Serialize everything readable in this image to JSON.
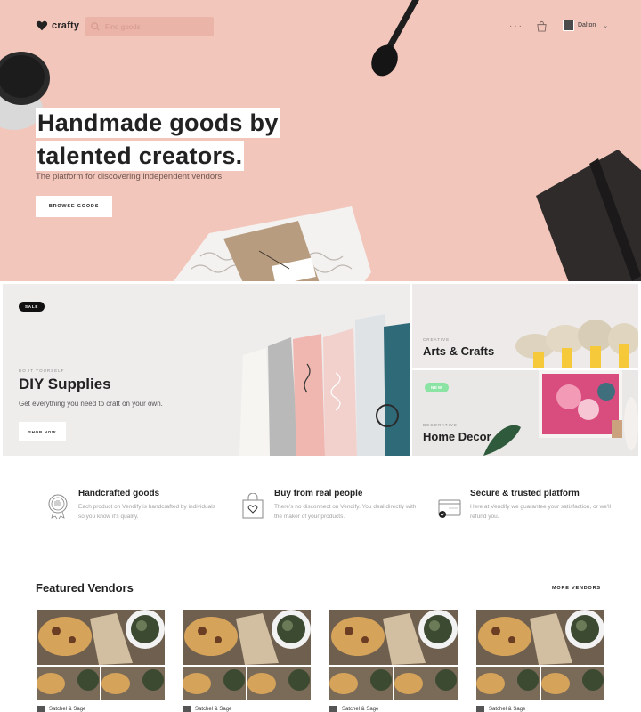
{
  "nav": {
    "logo_text": "crafty",
    "search_placeholder": "Find goods",
    "more_label": "···",
    "user_name": "Dalton"
  },
  "hero": {
    "title_line1": "Handmade goods by",
    "title_line2": "talented creators.",
    "subtitle": "The platform for discovering independent vendors.",
    "button_label": "BROWSE GOODS",
    "background": "#f3c6bb"
  },
  "tiles": {
    "diy": {
      "badge": "SALE",
      "kicker": "DO IT YOURSELF",
      "title": "DIY Supplies",
      "description": "Get everything you need to craft on your own.",
      "button_label": "SHOP NOW"
    },
    "arts": {
      "kicker": "CREATIVE",
      "title": "Arts & Crafts"
    },
    "home": {
      "badge": "NEW",
      "kicker": "DECORATIVE",
      "title": "Home Decor"
    }
  },
  "features": [
    {
      "icon": "medal-hand-icon",
      "title": "Handcrafted goods",
      "description": "Each product on Vendify is handcrafted by individuals so you know it's quality."
    },
    {
      "icon": "shopping-bag-heart-icon",
      "title": "Buy from real people",
      "description": "There's no disconnect on Vendify. You deal directly with the maker of your products."
    },
    {
      "icon": "credit-card-check-icon",
      "title": "Secure & trusted platform",
      "description": "Here at Vendify we guarantee your satisfaction, or we'll refund you."
    }
  ],
  "vendors": {
    "title": "Featured Vendors",
    "more_label": "MORE VENDORS",
    "cards": [
      {
        "name": "Satchel & Sage"
      },
      {
        "name": "Satchel & Sage"
      },
      {
        "name": "Satchel & Sage"
      },
      {
        "name": "Satchel & Sage"
      }
    ]
  },
  "colors": {
    "accent_pink": "#f3c6bb",
    "badge_new": "#8be3a4",
    "badge_sale": "#111111"
  }
}
